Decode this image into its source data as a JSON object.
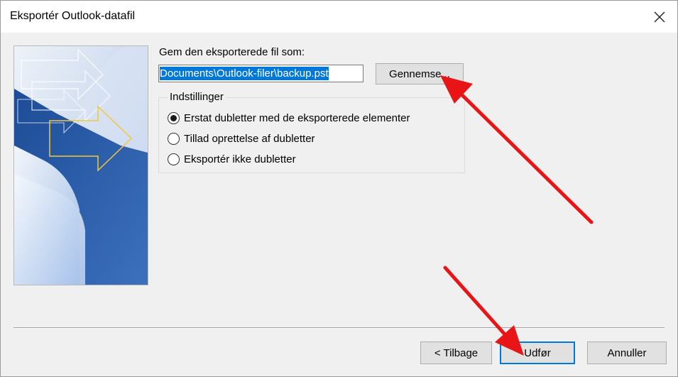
{
  "window": {
    "title": "Eksportér Outlook-datafil",
    "close_icon": "close-icon"
  },
  "save": {
    "label": "Gem den eksporterede fil som:",
    "path_value": "Documents\\Outlook-filer\\backup.pst",
    "browse_label": "Gennemse..."
  },
  "options": {
    "legend": "Indstillinger",
    "items": [
      {
        "label": "Erstat dubletter med de eksporterede elementer",
        "checked": true
      },
      {
        "label": "Tillad oprettelse af dubletter",
        "checked": false
      },
      {
        "label": "Eksportér ikke dubletter",
        "checked": false
      }
    ]
  },
  "buttons": {
    "back": "< Tilbage",
    "finish": "Udfør",
    "cancel": "Annuller"
  },
  "colors": {
    "annotation_arrow": "#e81416",
    "selection": "#0078d7",
    "banner_blue": "#2f5fa8",
    "banner_accent": "#f0c93a"
  },
  "annotations": [
    {
      "type": "arrow",
      "points_to": "browse-button"
    },
    {
      "type": "arrow",
      "points_to": "finish-button"
    }
  ]
}
